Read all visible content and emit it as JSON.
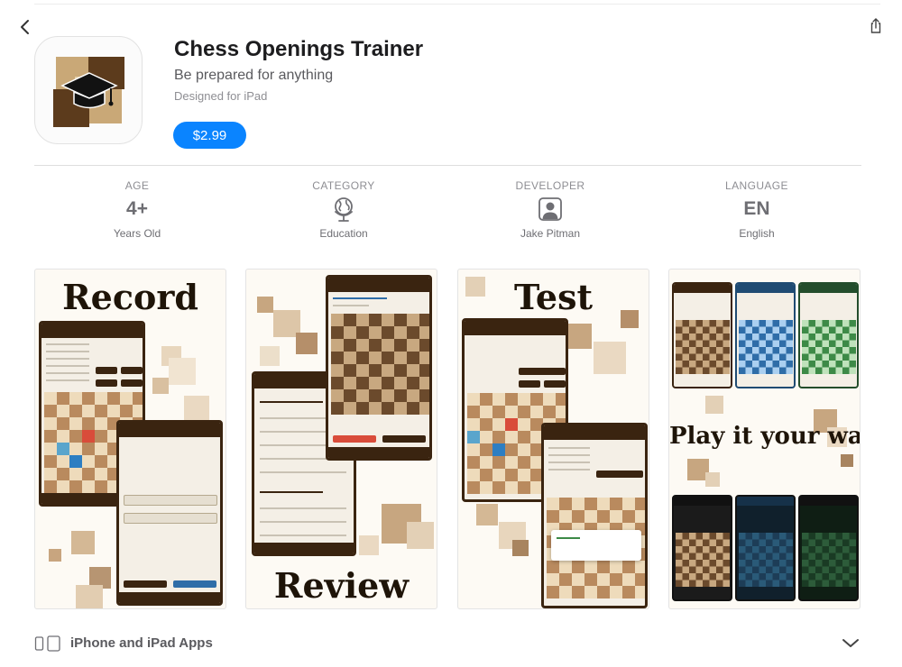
{
  "app": {
    "title": "Chess Openings Trainer",
    "subtitle": "Be prepared for anything",
    "designed_for": "Designed for iPad",
    "price": "$2.99"
  },
  "info": {
    "age": {
      "label": "AGE",
      "value": "4+",
      "sub": "Years Old"
    },
    "category": {
      "label": "CATEGORY",
      "icon": "globe-icon",
      "sub": "Education"
    },
    "developer": {
      "label": "DEVELOPER",
      "icon": "person-icon",
      "sub": "Jake Pitman"
    },
    "language": {
      "label": "LANGUAGE",
      "value": "EN",
      "sub": "English"
    }
  },
  "screenshots": {
    "record": "Record",
    "review": "Review",
    "test": "Test",
    "play": "Play it your way"
  },
  "footer": {
    "label": "iPhone and iPad Apps",
    "devices_icon": "iphone-ipad-icon",
    "chevron_icon": "chevron-down-icon"
  },
  "colors": {
    "accent": "#0a84ff",
    "brown_dark": "#3a2410",
    "board_light": "#eedbbb",
    "board_dark": "#b98a5e"
  }
}
